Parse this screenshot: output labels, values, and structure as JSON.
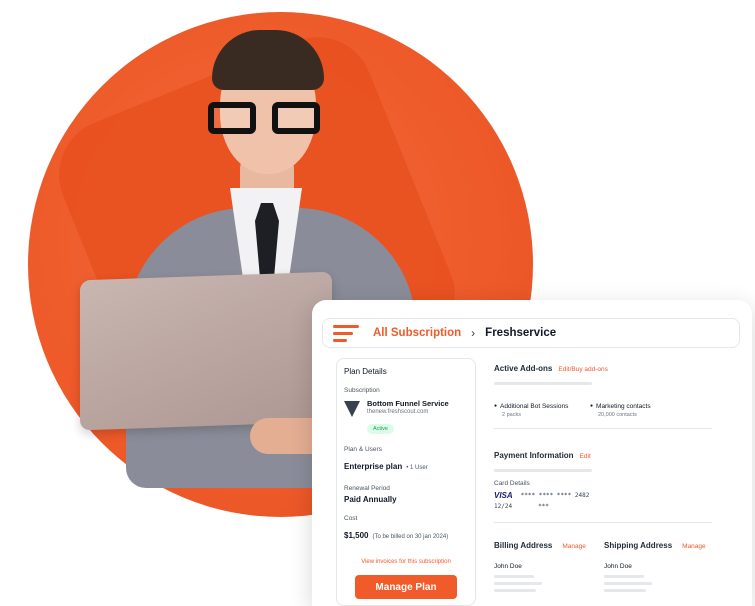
{
  "breadcrumb": {
    "parent": "All Subscription",
    "separator": "›",
    "current": "Freshservice"
  },
  "plan_details": {
    "heading": "Plan Details",
    "subscription_label": "Subscription",
    "service_name": "Bottom Funnel Service",
    "service_url": "thenew.freshscout.com",
    "status": "Active",
    "plan_users_label": "Plan & Users",
    "plan_name": "Enterprise plan",
    "plan_users": "• 1 User",
    "renewal_label": "Renewal Period",
    "renewal_value": "Paid Annually",
    "cost_label": "Cost",
    "cost_value": "$1,500",
    "cost_note": "(To be billed on 30 jan 2024)",
    "invoices_link": "View invoices for this subscription",
    "manage_button": "Manage Plan"
  },
  "addons": {
    "title": "Active Add-ons",
    "edit_link": "Edit/Buy add-ons",
    "items": [
      {
        "name": "Additional Bot Sessions",
        "value": "2 packs"
      },
      {
        "name": "Marketing contacts",
        "value": "20,000 contacts"
      }
    ]
  },
  "payment": {
    "title": "Payment Information",
    "edit_link": "Edit",
    "card_label": "Card Details",
    "card_brand": "VISA",
    "card_number": "**** **** **** 2482",
    "card_expiry": "12/24",
    "card_cvv": "***"
  },
  "billing": {
    "title": "Billing Address",
    "manage_link": "Manage",
    "name": "John Doe"
  },
  "shipping": {
    "title": "Shipping Address",
    "manage_link": "Manage",
    "name": "John Doe"
  },
  "colors": {
    "accent": "#f15a29",
    "hero": "#ee5a2a"
  }
}
